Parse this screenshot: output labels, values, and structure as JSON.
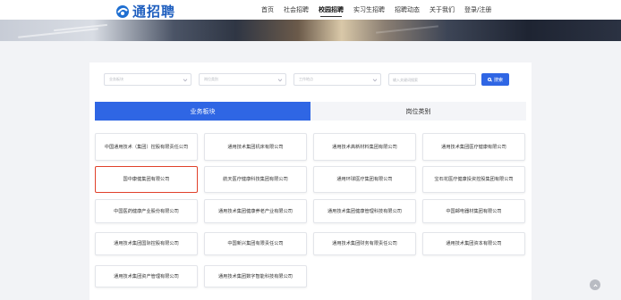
{
  "header": {
    "logo_text": "通招聘",
    "nav": [
      {
        "label": "首页",
        "active": false
      },
      {
        "label": "社会招聘",
        "active": false
      },
      {
        "label": "校园招聘",
        "active": true
      },
      {
        "label": "实习生招聘",
        "active": false
      },
      {
        "label": "招聘动态",
        "active": false
      },
      {
        "label": "关于我们",
        "active": false
      },
      {
        "label": "登录/注册",
        "active": false
      }
    ]
  },
  "filters": {
    "selects": [
      "业务板块",
      "岗位类别",
      "工作地点"
    ],
    "search_placeholder": "输入关键词搜索",
    "search_button": "搜索"
  },
  "tabs": [
    {
      "label": "业务板块",
      "active": true
    },
    {
      "label": "岗位类别",
      "active": false
    }
  ],
  "companies": [
    "中国通用技术（集团）控股有限责任公司",
    "通用技术集团机床有限公司",
    "通用技术高新材料集团有限公司",
    "通用技术集团医疗健康有限公司",
    "国中康健集团有限公司",
    "航天医疗健康科技集团有限公司",
    "通用环球医疗集团有限公司",
    "宝石花医疗健康投资控股集团有限公司",
    "中国医药健康产业股份有限公司",
    "通用技术集团健康养老产业有限公司",
    "通用技术集团健康管理科技有限公司",
    "中国邮电器材集团有限公司",
    "通用技术集团国际控股有限公司",
    "中国新兴集团有限责任公司",
    "通用技术集团财务有限责任公司",
    "通用技术集团资本有限公司",
    "通用技术集团资产管理有限公司",
    "通用技术集团数字智能科技有限公司"
  ],
  "highlighted_company": "国中康健集团有限公司",
  "colors": {
    "accent": "#2f66e4",
    "highlight_border": "#e0402a"
  }
}
